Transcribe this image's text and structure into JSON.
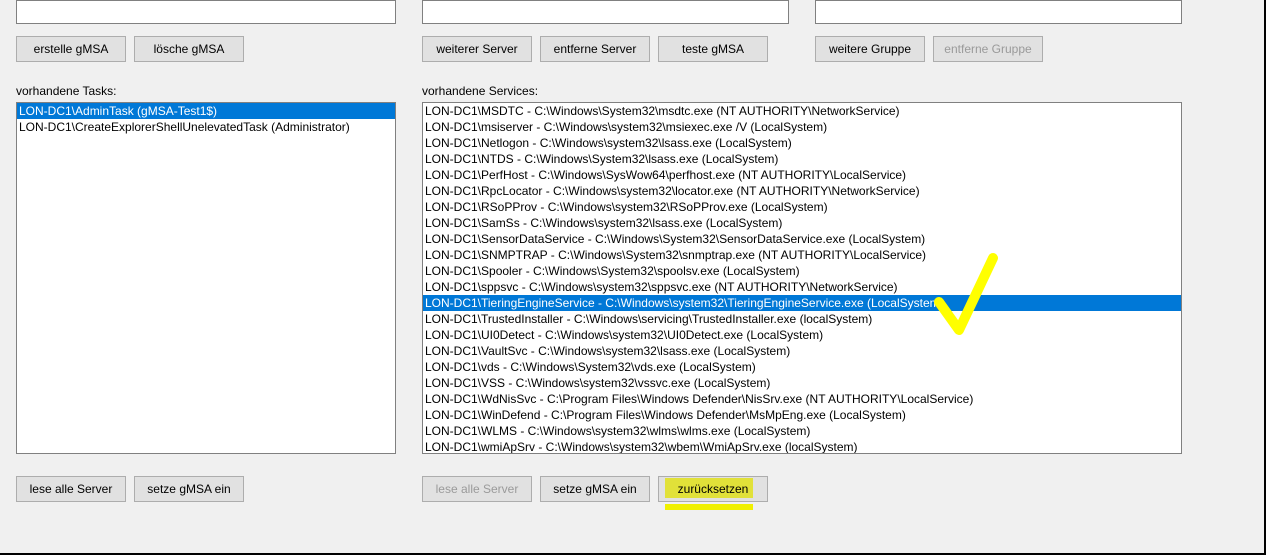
{
  "buttons": {
    "erstelle_gmsa": "erstelle gMSA",
    "loesche_gmsa": "lösche gMSA",
    "weiterer_server": "weiterer Server",
    "entferne_server": "entferne Server",
    "teste_gmsa": "teste gMSA",
    "weitere_gruppe": "weitere Gruppe",
    "entferne_gruppe": "entferne Gruppe",
    "lese_alle_server_left": "lese alle Server",
    "setze_gmsa_ein_left": "setze gMSA ein",
    "lese_alle_server_mid": "lese alle Server",
    "setze_gmsa_ein_mid": "setze gMSA ein",
    "zuruecksetzen": "zurücksetzen"
  },
  "labels": {
    "vorhandene_tasks": "vorhandene Tasks:",
    "vorhandene_services": "vorhandene Services:"
  },
  "tasks": [
    {
      "text": "LON-DC1\\AdminTask (gMSA-Test1$)",
      "selected": true
    },
    {
      "text": "LON-DC1\\CreateExplorerShellUnelevatedTask (Administrator)",
      "selected": false
    }
  ],
  "services": [
    {
      "text": "LON-DC1\\MSDTC - C:\\Windows\\System32\\msdtc.exe (NT AUTHORITY\\NetworkService)",
      "selected": false
    },
    {
      "text": "LON-DC1\\msiserver - C:\\Windows\\system32\\msiexec.exe /V (LocalSystem)",
      "selected": false
    },
    {
      "text": "LON-DC1\\Netlogon - C:\\Windows\\system32\\lsass.exe (LocalSystem)",
      "selected": false
    },
    {
      "text": "LON-DC1\\NTDS - C:\\Windows\\System32\\lsass.exe (LocalSystem)",
      "selected": false
    },
    {
      "text": "LON-DC1\\PerfHost - C:\\Windows\\SysWow64\\perfhost.exe (NT AUTHORITY\\LocalService)",
      "selected": false
    },
    {
      "text": "LON-DC1\\RpcLocator - C:\\Windows\\system32\\locator.exe (NT AUTHORITY\\NetworkService)",
      "selected": false
    },
    {
      "text": "LON-DC1\\RSoPProv - C:\\Windows\\system32\\RSoPProv.exe (LocalSystem)",
      "selected": false
    },
    {
      "text": "LON-DC1\\SamSs - C:\\Windows\\system32\\lsass.exe (LocalSystem)",
      "selected": false
    },
    {
      "text": "LON-DC1\\SensorDataService - C:\\Windows\\System32\\SensorDataService.exe (LocalSystem)",
      "selected": false
    },
    {
      "text": "LON-DC1\\SNMPTRAP - C:\\Windows\\System32\\snmptrap.exe (NT AUTHORITY\\LocalService)",
      "selected": false
    },
    {
      "text": "LON-DC1\\Spooler - C:\\Windows\\System32\\spoolsv.exe (LocalSystem)",
      "selected": false
    },
    {
      "text": "LON-DC1\\sppsvc - C:\\Windows\\system32\\sppsvc.exe (NT AUTHORITY\\NetworkService)",
      "selected": false
    },
    {
      "text": "LON-DC1\\TieringEngineService - C:\\Windows\\system32\\TieringEngineService.exe (LocalSystem)",
      "selected": true
    },
    {
      "text": "LON-DC1\\TrustedInstaller - C:\\Windows\\servicing\\TrustedInstaller.exe (localSystem)",
      "selected": false
    },
    {
      "text": "LON-DC1\\UI0Detect - C:\\Windows\\system32\\UI0Detect.exe (LocalSystem)",
      "selected": false
    },
    {
      "text": "LON-DC1\\VaultSvc - C:\\Windows\\system32\\lsass.exe (LocalSystem)",
      "selected": false
    },
    {
      "text": "LON-DC1\\vds - C:\\Windows\\System32\\vds.exe (LocalSystem)",
      "selected": false
    },
    {
      "text": "LON-DC1\\VSS - C:\\Windows\\system32\\vssvc.exe (LocalSystem)",
      "selected": false
    },
    {
      "text": "LON-DC1\\WdNisSvc - C:\\Program Files\\Windows Defender\\NisSrv.exe (NT AUTHORITY\\LocalService)",
      "selected": false
    },
    {
      "text": "LON-DC1\\WinDefend - C:\\Program Files\\Windows Defender\\MsMpEng.exe (LocalSystem)",
      "selected": false
    },
    {
      "text": "LON-DC1\\WLMS - C:\\Windows\\system32\\wlms\\wlms.exe (LocalSystem)",
      "selected": false
    },
    {
      "text": "LON-DC1\\wmiApSrv - C:\\Windows\\system32\\wbem\\WmiApSrv.exe (localSystem)",
      "selected": false
    }
  ],
  "highlights": {
    "service_checkmark": true,
    "button_zuruecksetzen": true
  }
}
